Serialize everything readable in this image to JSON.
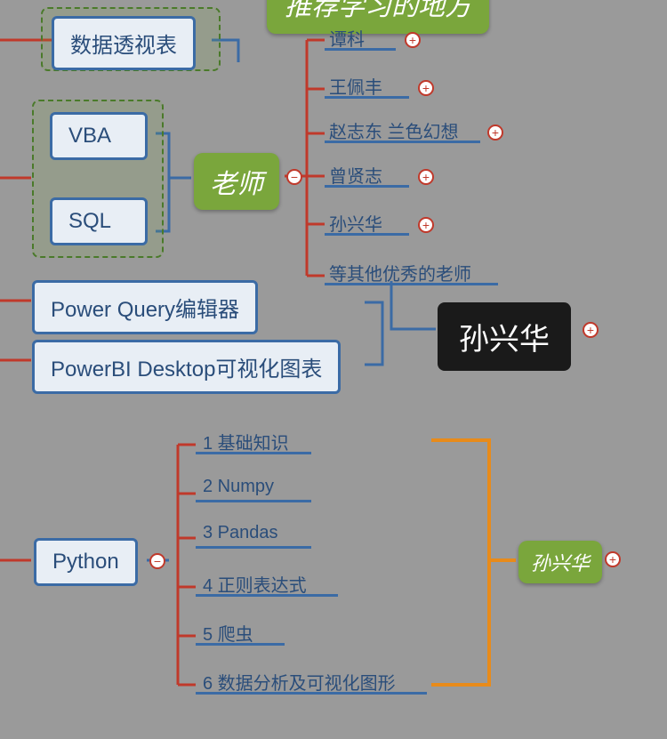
{
  "top_green": "推荐学习的地方",
  "pivot": "数据透视表",
  "vba": "VBA",
  "sql": "SQL",
  "teacher_label": "老师",
  "teachers": {
    "t1": "谭科",
    "t2": "王佩丰",
    "t3": "赵志东 兰色幻想",
    "t4": "曾贤志",
    "t5": "孙兴华",
    "t6": "等其他优秀的老师"
  },
  "black_node": "孙兴华",
  "pq": "Power Query编辑器",
  "pbi": "PowerBI Desktop可视化图表",
  "python": "Python",
  "python_items": {
    "p1": "1 基础知识",
    "p2": "2 Numpy",
    "p3": "3 Pandas",
    "p4": "4 正则表达式",
    "p5": "5 爬虫",
    "p6": "6 数据分析及可视化图形"
  },
  "right_green": "孙兴华",
  "plus": "+",
  "minus": "−"
}
